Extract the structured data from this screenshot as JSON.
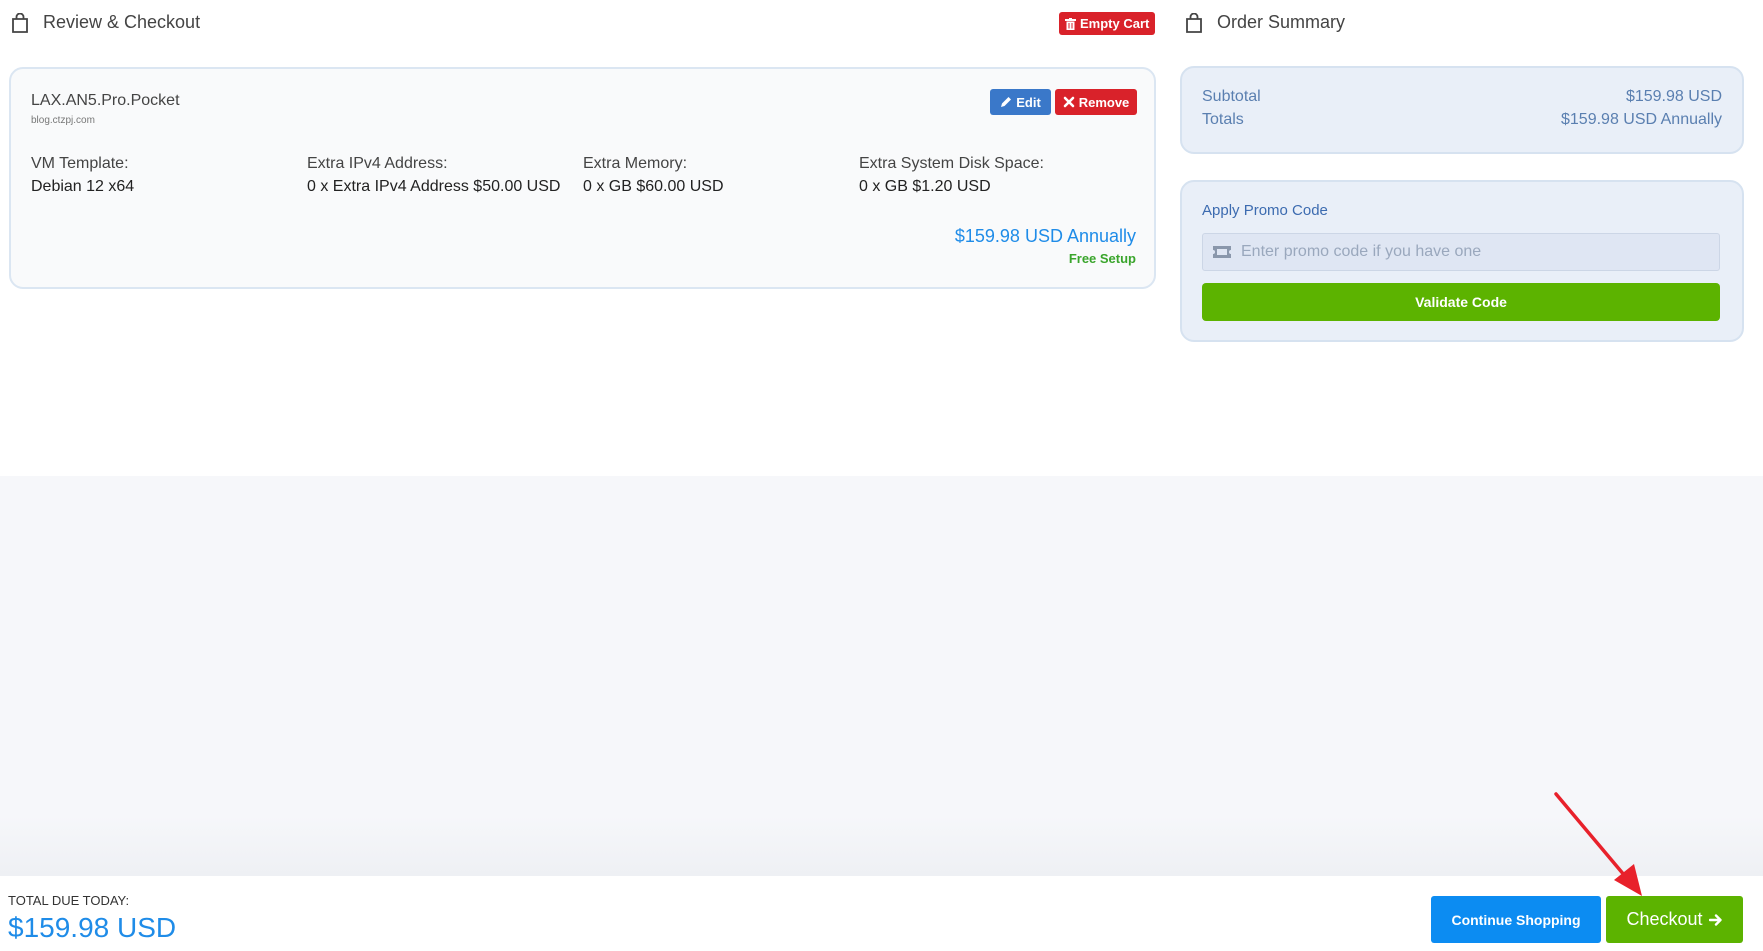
{
  "header": {
    "review_title": "Review & Checkout",
    "empty_cart_label": "Empty Cart",
    "summary_title": "Order Summary"
  },
  "product": {
    "name": "LAX.AN5.Pro.Pocket",
    "domain": "blog.ctzpj.com",
    "edit_label": "Edit",
    "remove_label": "Remove",
    "options": [
      {
        "label": "VM Template:",
        "value": "Debian 12 x64"
      },
      {
        "label": "Extra IPv4 Address:",
        "value": "0 x Extra IPv4 Address $50.00 USD"
      },
      {
        "label": "Extra Memory:",
        "value": "0 x GB $60.00 USD"
      },
      {
        "label": "Extra System Disk Space:",
        "value": "0 x GB $1.20 USD"
      }
    ],
    "price": "$159.98 USD Annually",
    "setup": "Free Setup"
  },
  "summary": {
    "subtotal_label": "Subtotal",
    "subtotal_value": "$159.98 USD",
    "totals_label": "Totals",
    "totals_value": "$159.98 USD Annually"
  },
  "promo": {
    "title": "Apply Promo Code",
    "placeholder": "Enter promo code if you have one",
    "validate_label": "Validate Code"
  },
  "footer": {
    "due_label": "TOTAL DUE TODAY:",
    "due_value": "$159.98 USD",
    "continue_label": "Continue Shopping",
    "checkout_label": "Checkout"
  },
  "colors": {
    "accent_blue": "#1f8ce8",
    "danger_red": "#d9222a",
    "success_green": "#5cb300",
    "annotation_arrow": "#e8212b"
  },
  "icons": [
    "shopping-bag-icon",
    "trash-icon",
    "pencil-icon",
    "times-icon",
    "ticket-icon",
    "arrow-right-icon"
  ]
}
